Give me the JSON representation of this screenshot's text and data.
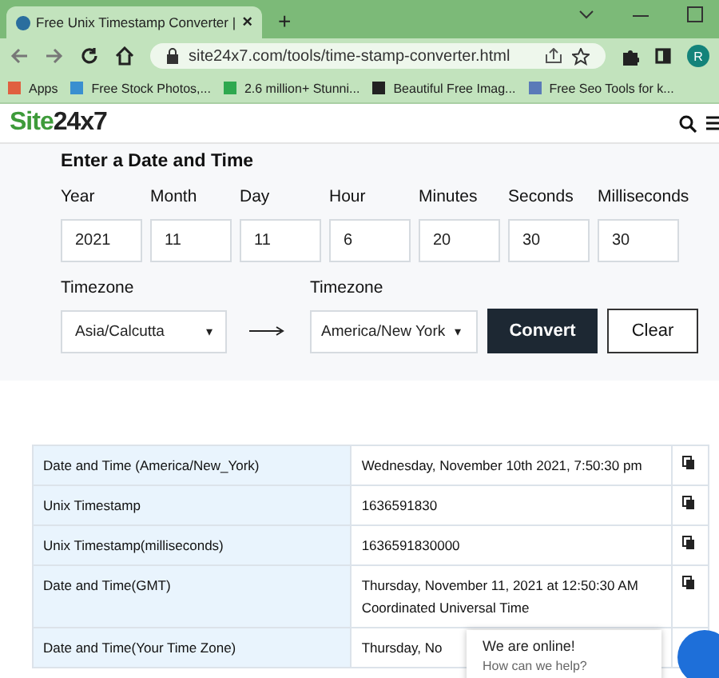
{
  "browser": {
    "tab_title": "Free Unix Timestamp Converter |",
    "tab_close": "×",
    "new_tab": "+",
    "url": "site24x7.com/tools/time-stamp-converter.html",
    "profile": "R",
    "bookmarks": [
      {
        "label": "Apps"
      },
      {
        "label": "Free Stock Photos,..."
      },
      {
        "label": "2.6 million+ Stunni..."
      },
      {
        "label": "Beautiful Free Imag..."
      },
      {
        "label": "Free Seo Tools for k..."
      }
    ]
  },
  "site": {
    "logo_green": "Site",
    "logo_dark": "24x7"
  },
  "form": {
    "title": "Enter a Date and Time",
    "fields": [
      {
        "label": "Year",
        "value": "2021"
      },
      {
        "label": "Month",
        "value": "11"
      },
      {
        "label": "Day",
        "value": "11"
      },
      {
        "label": "Hour",
        "value": "6"
      },
      {
        "label": "Minutes",
        "value": "20"
      },
      {
        "label": "Seconds",
        "value": "30"
      },
      {
        "label": "Milliseconds",
        "value": "30"
      }
    ],
    "from_timezone": {
      "label": "Timezone",
      "value": "Asia/Calcutta",
      "caret": "▾"
    },
    "to_timezone": {
      "label": "Timezone",
      "value": "America/New York",
      "caret": "▾"
    },
    "buttons": [
      {
        "label": "Convert",
        "kind": "primary"
      },
      {
        "label": "Clear",
        "kind": "secondary"
      }
    ]
  },
  "results": [
    {
      "label": "Date and Time (America/New_York)",
      "value": "Wednesday, November 10th 2021, 7:50:30 pm"
    },
    {
      "label": "Unix Timestamp",
      "value": "1636591830"
    },
    {
      "label": "Unix Timestamp(milliseconds)",
      "value": "1636591830000"
    },
    {
      "label": "Date and Time(GMT)",
      "value": "Thursday, November 11, 2021 at 12:50:30 AM Coordinated Universal Time"
    },
    {
      "label": "Date and Time(Your Time Zone)",
      "value": "Thursday, No"
    }
  ],
  "chat": {
    "title": "We are online!",
    "subtitle": "How can we help?"
  }
}
